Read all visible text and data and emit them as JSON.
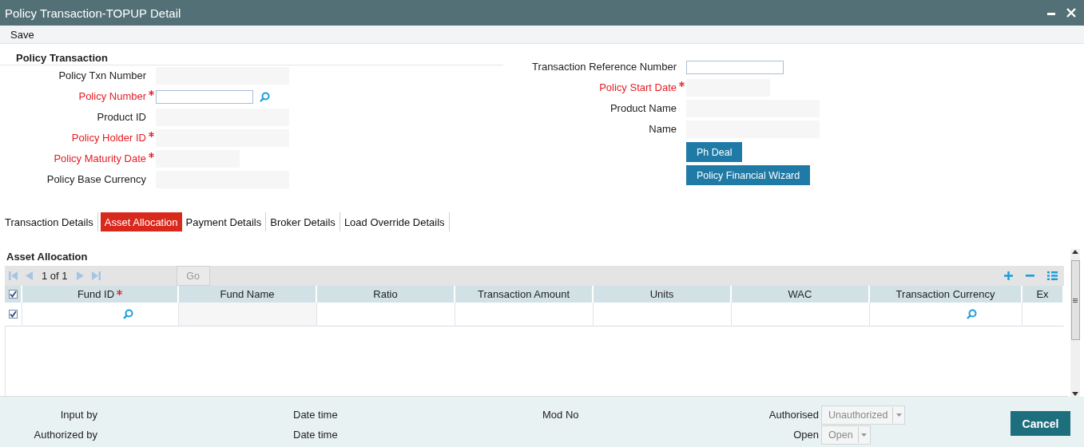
{
  "window": {
    "title": "Policy Transaction-TOPUP Detail"
  },
  "toolbar": [
    "Save"
  ],
  "form": {
    "title": "Policy Transaction",
    "left_fields": [
      {
        "label": "Policy Txn Number",
        "required": false,
        "kind": "readonly"
      },
      {
        "label": "Policy Number",
        "required": true,
        "kind": "lookup"
      },
      {
        "label": "Product ID",
        "required": false,
        "kind": "readonly"
      },
      {
        "label": "Policy Holder ID",
        "required": true,
        "kind": "readonly"
      },
      {
        "label": "Policy Maturity Date",
        "required": true,
        "kind": "date"
      },
      {
        "label": "Policy Base Currency",
        "required": false,
        "kind": "readonly"
      }
    ],
    "right_fields": [
      {
        "label": "Transaction Reference Number",
        "required": false,
        "kind": "input"
      },
      {
        "label": "Policy Start Date",
        "required": true,
        "kind": "date"
      },
      {
        "label": "Product Name",
        "required": false,
        "kind": "readonly"
      },
      {
        "label": "Name",
        "required": false,
        "kind": "readonly"
      }
    ],
    "buttons": [
      "Ph Deal",
      "Policy Financial Wizard"
    ]
  },
  "tabs": [
    {
      "label": "Transaction Details",
      "selected": false
    },
    {
      "label": "Asset Allocation",
      "selected": true
    },
    {
      "label": "Payment Details",
      "selected": false
    },
    {
      "label": "Broker Details",
      "selected": false
    },
    {
      "label": "Load Override Details",
      "selected": false
    }
  ],
  "grid": {
    "title": "Asset Allocation",
    "pager": "1 of 1",
    "go": "Go",
    "header_checked": true,
    "columns": [
      {
        "label": "Fund ID",
        "required": true
      },
      {
        "label": "Fund Name",
        "required": false
      },
      {
        "label": "Ratio",
        "required": false
      },
      {
        "label": "Transaction Amount",
        "required": false
      },
      {
        "label": "Units",
        "required": false
      },
      {
        "label": "WAC",
        "required": false
      },
      {
        "label": "Transaction Currency",
        "required": false
      },
      {
        "label": "Ex",
        "required": false
      }
    ],
    "rows": [
      {
        "checked": true,
        "cells": [
          {
            "kind": "lookup"
          },
          {
            "kind": "readonly"
          },
          {
            "kind": "input"
          },
          {
            "kind": "input"
          },
          {
            "kind": "input"
          },
          {
            "kind": "input"
          },
          {
            "kind": "lookup"
          },
          {
            "kind": "input"
          }
        ]
      }
    ]
  },
  "footer": {
    "fields": [
      {
        "label": "Input by",
        "kind": "user"
      },
      {
        "label": "Date time",
        "kind": "date"
      },
      {
        "label": "Mod No",
        "kind": "mod"
      },
      {
        "label": "Authorised",
        "kind": "status",
        "select": "Unauthorized"
      },
      {
        "label": "Authorized by",
        "kind": "user"
      },
      {
        "label": "Date time",
        "kind": "date"
      },
      {
        "label": "Open",
        "kind": "status",
        "select": "Open"
      }
    ],
    "button": "Cancel"
  }
}
